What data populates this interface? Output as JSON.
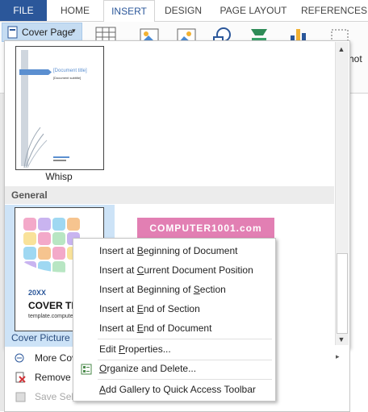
{
  "ribbon": {
    "tabs": [
      "FILE",
      "HOME",
      "INSERT",
      "DESIGN",
      "PAGE LAYOUT",
      "REFERENCES"
    ],
    "cover_page_label": "Cover Page",
    "partial_label": "hot"
  },
  "gallery": {
    "whisp": {
      "label": "Whisp",
      "doc_title": "[Document title]",
      "doc_subtitle": "[Document subtitle]"
    },
    "section_header": "General",
    "cover_picture": {
      "label_visible": "Cover Picture i",
      "year": "20XX",
      "title": "COVER TIT",
      "url": "template.computert"
    },
    "computer1001": "COMPUTER1001.com"
  },
  "bottom_menu": {
    "more": "More Cov",
    "remove": "Remove C",
    "save": "Save Selec"
  },
  "context_menu": {
    "items": [
      {
        "pre": "Insert at ",
        "ul": "B",
        "post": "eginning of Document"
      },
      {
        "pre": "Insert at ",
        "ul": "C",
        "post": "urrent Document Position"
      },
      {
        "pre": "Insert at Beginning of ",
        "ul": "S",
        "post": "ection"
      },
      {
        "pre": "Insert at ",
        "ul": "E",
        "post": "nd of Section"
      },
      {
        "pre": "Insert at ",
        "ul": "E",
        "post": "nd of Document"
      },
      {
        "pre": "Edit ",
        "ul": "P",
        "post": "roperties..."
      },
      {
        "pre": "",
        "ul": "O",
        "post": "rganize and Delete..."
      },
      {
        "pre": "",
        "ul": "A",
        "post": "dd Gallery to Quick Access Toolbar"
      }
    ]
  }
}
